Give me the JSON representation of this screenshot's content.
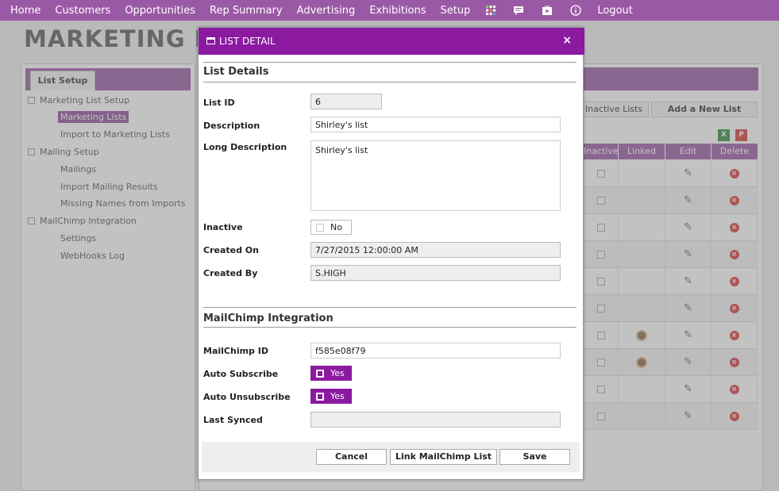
{
  "nav": {
    "items": [
      "Home",
      "Customers",
      "Opportunities",
      "Rep Summary",
      "Advertising",
      "Exhibitions",
      "Setup"
    ],
    "logout": "Logout",
    "icons": [
      "grid-icon",
      "chat-icon",
      "video-icon",
      "info-icon"
    ]
  },
  "page": {
    "title": "MARKETING LISTS"
  },
  "left": {
    "tab": "List Setup",
    "tree": [
      {
        "label": "Marketing List Setup",
        "level": 0,
        "selected": false
      },
      {
        "label": "Marketing Lists",
        "level": 1,
        "selected": true
      },
      {
        "label": "Import to Marketing Lists",
        "level": 1,
        "selected": false
      },
      {
        "label": "Mailing Setup",
        "level": 0,
        "selected": false
      },
      {
        "label": "Mailings",
        "level": 1,
        "selected": false
      },
      {
        "label": "Import Mailing Results",
        "level": 1,
        "selected": false
      },
      {
        "label": "Missing Names from Imports",
        "level": 1,
        "selected": false
      },
      {
        "label": "MailChimp Integration",
        "level": 0,
        "selected": false
      },
      {
        "label": "Settings",
        "level": 1,
        "selected": false
      },
      {
        "label": "WebHooks Log",
        "level": 1,
        "selected": false
      }
    ]
  },
  "right": {
    "inactive_lists_button": "Inactive Lists",
    "add_button": "Add a New List",
    "columns": [
      "Inactive",
      "Linked",
      "Edit",
      "Delete"
    ],
    "rows": [
      {
        "linked": false
      },
      {
        "linked": false
      },
      {
        "linked": false
      },
      {
        "linked": false
      },
      {
        "linked": false
      },
      {
        "linked": false
      },
      {
        "linked": true
      },
      {
        "linked": true
      },
      {
        "linked": false
      },
      {
        "linked": false
      }
    ]
  },
  "dialog": {
    "title": "LIST DETAIL",
    "close": "×",
    "details_section": "List Details",
    "list_id_label": "List ID",
    "list_id": "6",
    "description_label": "Description",
    "description": "Shirley's list",
    "long_description_label": "Long Description",
    "long_description": "Shirley's list",
    "inactive_label": "Inactive",
    "inactive_value": "No",
    "created_on_label": "Created On",
    "created_on": "7/27/2015 12:00:00 AM",
    "created_by_label": "Created By",
    "created_by": "S.HIGH",
    "mailchimp_section": "MailChimp Integration",
    "mailchimp_id_label": "MailChimp ID",
    "mailchimp_id": "f585e08f79",
    "auto_subscribe_label": "Auto Subscribe",
    "auto_subscribe_value": "Yes",
    "auto_unsubscribe_label": "Auto Unsubscribe",
    "auto_unsubscribe_value": "Yes",
    "last_synced_label": "Last Synced",
    "last_synced": "",
    "cancel": "Cancel",
    "link": "Link MailChimp List",
    "save": "Save"
  },
  "colors": {
    "nav_bg": "#9a59a4",
    "dialog_title_bg": "#8b1aa1",
    "toggle_on": "#8b1aa1"
  }
}
